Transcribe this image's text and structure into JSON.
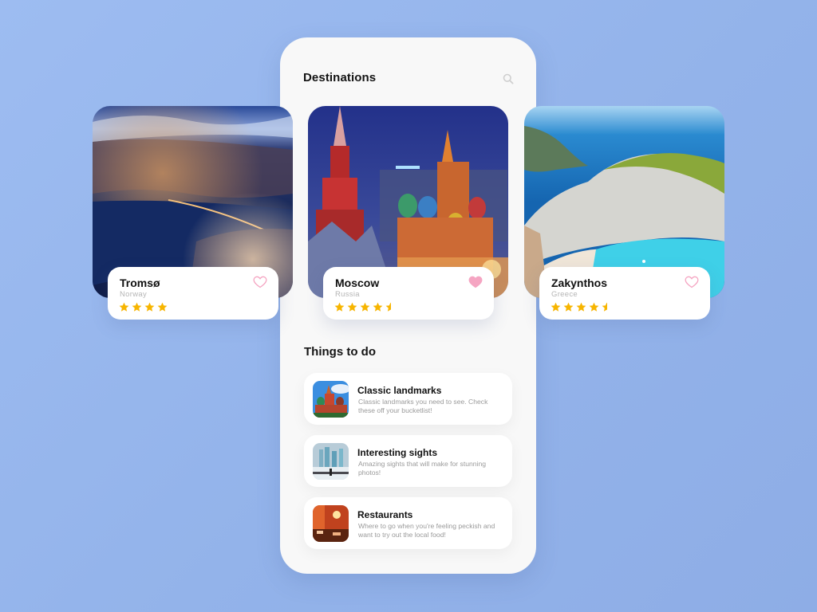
{
  "header": {
    "title": "Destinations",
    "search_icon": "search-icon"
  },
  "destinations": [
    {
      "name": "Tromsø",
      "country": "Norway",
      "rating": 4,
      "favorited": false,
      "image": "tromso-night-city-photo"
    },
    {
      "name": "Moscow",
      "country": "Russia",
      "rating": 4.5,
      "favorited": true,
      "image": "moscow-st-basils-cathedral-photo"
    },
    {
      "name": "Zakynthos",
      "country": "Greece",
      "rating": 4.5,
      "favorited": false,
      "image": "zakynthos-navagio-beach-photo"
    }
  ],
  "things_to_do": {
    "title": "Things to do",
    "items": [
      {
        "title": "Classic landmarks",
        "description": "Classic landmarks you need to see. Check these off your bucketlist!",
        "image": "cathedral-thumbnail"
      },
      {
        "title": "Interesting sights",
        "description": "Amazing sights that will make for stunning photos!",
        "image": "foggy-skyline-thumbnail"
      },
      {
        "title": "Restaurants",
        "description": "Where to go when you're feeling peckish and want to try out the local food!",
        "image": "restaurant-interior-thumbnail"
      }
    ]
  },
  "colors": {
    "background": "#97b6ec",
    "star": "#f7b500",
    "heart": "#f5a5c2",
    "panel": "#f8f8f8"
  }
}
